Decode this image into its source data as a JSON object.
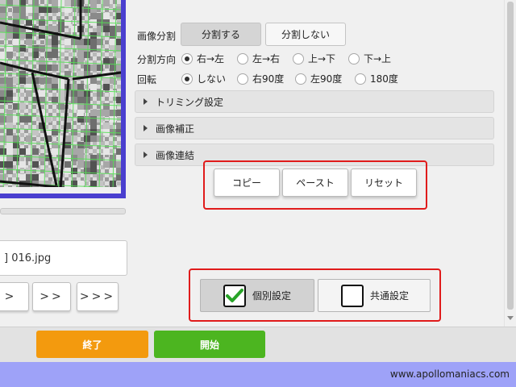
{
  "preview": {
    "filename": "] 016.jpg",
    "nav_buttons": [
      ">",
      ">>",
      ">>>"
    ]
  },
  "settings": {
    "split_label": "画像分割",
    "split_on": "分割する",
    "split_off": "分割しない",
    "direction_label": "分割方向",
    "direction_options": [
      "右→左",
      "左→右",
      "上→下",
      "下→上"
    ],
    "direction_selected": "右→左",
    "rotation_label": "回転",
    "rotation_options": [
      "しない",
      "右90度",
      "左90度",
      "180度"
    ],
    "rotation_selected": "しない",
    "sections": [
      "トリミング設定",
      "画像補正",
      "画像連結"
    ],
    "copy_label": "コピー",
    "paste_label": "ペースト",
    "reset_label": "リセット",
    "individual_label": "個別設定",
    "individual_checked": true,
    "common_label": "共通設定",
    "common_checked": false
  },
  "footer": {
    "exit_label": "終了",
    "start_label": "開始",
    "site": "www.apollomaniacs.com"
  },
  "colors": {
    "exit": "#f39a0e",
    "start": "#4cb520",
    "highlight_frame": "#e01b1b",
    "bottom_strip": "#9ea2f8"
  }
}
